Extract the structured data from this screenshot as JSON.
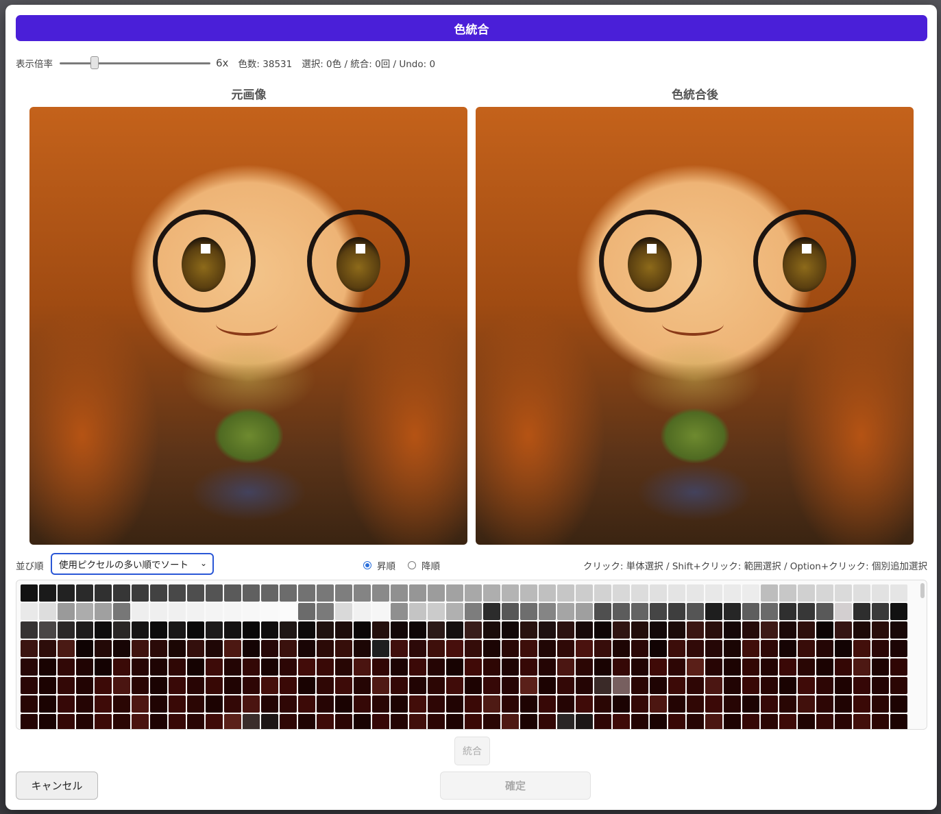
{
  "title": "色統合",
  "zoom": {
    "label": "表示倍率",
    "value_text": "6x",
    "slider_level": 6
  },
  "stats": {
    "colors": "色数: 38531",
    "selection": "選択: 0色 / 統合: 0回 / Undo: 0"
  },
  "panels": {
    "original_title": "元画像",
    "merged_title": "色統合後"
  },
  "sort": {
    "label": "並び順",
    "selected": "使用ピクセルの多い順でソート",
    "ascending": "昇順",
    "descending": "降順",
    "order_selected": "ascending"
  },
  "hint": "クリック: 単体選択 / Shift+クリック: 範囲選択 / Option+クリック: 個別追加選択",
  "buttons": {
    "merge": "統合",
    "cancel": "キャンセル",
    "confirm": "確定"
  },
  "palette_colors": [
    "#121212",
    "#1a1a1a",
    "#222222",
    "#2a2a2a",
    "#303030",
    "#363636",
    "#3c3c3c",
    "#424242",
    "#484848",
    "#4e4e4e",
    "#545454",
    "#5a5a5a",
    "#606060",
    "#666666",
    "#6c6c6c",
    "#727272",
    "#787878",
    "#7e7e7e",
    "#848484",
    "#8a8a8a",
    "#909090",
    "#969696",
    "#9c9c9c",
    "#a2a2a2",
    "#a8a8a8",
    "#aeaeae",
    "#b4b4b4",
    "#bababa",
    "#c0c0c0",
    "#c6c6c6",
    "#cccccc",
    "#d2d2d2",
    "#d8d8d8",
    "#dcdcdc",
    "#e0e0e0",
    "#e4e4e4",
    "#e6e6e6",
    "#e8e8e8",
    "#eaeaea",
    "#ececec",
    "#bdbdbd",
    "#c7c7c7",
    "#d0d0d0",
    "#d6d6d6",
    "#dadada",
    "#dedede",
    "#e2e2e2",
    "#e5e5e5",
    "#e9e9e9",
    "#dddddd",
    "#9a9a9a",
    "#acacac",
    "#a0a0a0",
    "#777777",
    "#eeeeee",
    "#efefef",
    "#f0f0f0",
    "#f2f2f2",
    "#f4f4f4",
    "#f5f5f5",
    "#f7f7f7",
    "#f9f9f9",
    "#fbfbfb",
    "#6b6b6b",
    "#7a7a7a",
    "#d9d9d9",
    "#f1f1f1",
    "#f6f6f6",
    "#8f8f8f",
    "#c4c4c4",
    "#cbcbcb",
    "#b0b0b0",
    "#7d7d7d",
    "#2c2c2c",
    "#575757",
    "#6e6e6e",
    "#858585",
    "#a5a5a5",
    "#9f9f9f",
    "#4f4f4f",
    "#5c5c5c",
    "#646464",
    "#454545",
    "#3e3e3e",
    "#555555",
    "#1e1e1e",
    "#262626",
    "#5e5e5e",
    "#6a6a6a",
    "#2f2f2f",
    "#373737",
    "#595959",
    "#d3cfd0",
    "#2e2e2e",
    "#3a3a3a",
    "#111111",
    "#363333",
    "#4a4646",
    "#2b2828",
    "#1e1c1c",
    "#0e0d0d",
    "#2a2726",
    "#161414",
    "#0c0b0b",
    "#1a1818",
    "#0a0909",
    "#1c1a1a",
    "#141212",
    "#090808",
    "#0f0d0d",
    "#1f1715",
    "#0d0a0a",
    "#20120f",
    "#1d0d0b",
    "#0b0606",
    "#240f0c",
    "#120707",
    "#0f0606",
    "#2b1a18",
    "#151010",
    "#381d1a",
    "#1a0c0a",
    "#110808",
    "#28120f",
    "#1f1010",
    "#2c1210",
    "#170909",
    "#0e0505",
    "#301512",
    "#220d0b",
    "#130808",
    "#1b0b09",
    "#3a1612",
    "#2a0f0c",
    "#150707",
    "#250c0a",
    "#3d1a16",
    "#1c0908",
    "#2e100d",
    "#0d0404",
    "#351513",
    "#1e0a08",
    "#290e0b",
    "#190807",
    "#3b1410",
    "#2d0d0a",
    "#4a1a14",
    "#0f0303",
    "#230907",
    "#170505",
    "#3f130f",
    "#2a0a08",
    "#1b0604",
    "#330f0c",
    "#1f0706",
    "#4c1812",
    "#140404",
    "#260807",
    "#3a110d",
    "#190505",
    "#2b0a07",
    "#360e0a",
    "#1c0605",
    "#1e1f1f",
    "#400f0c",
    "#2c0908",
    "#3e0f0b",
    "#470f0c",
    "#340c09",
    "#1b0504",
    "#290806",
    "#3d0e0a",
    "#200605",
    "#2f0907",
    "#4a120e",
    "#370d0a",
    "#1d0504",
    "#2a0706",
    "#110303",
    "#3c0d0a",
    "#310a08",
    "#250706",
    "#1a0504",
    "#400e0a",
    "#2e0806",
    "#160404",
    "#380c09",
    "#240605",
    "#120303",
    "#420f0b",
    "#2b0706",
    "#1c0404",
    "#280706",
    "#190302",
    "#310806",
    "#200403",
    "#140202",
    "#3a0a07",
    "#270504",
    "#1e0403",
    "#2f0705",
    "#150302",
    "#3d0b08",
    "#230504",
    "#330806",
    "#1a0302",
    "#2c0605",
    "#420c09",
    "#390906",
    "#270604",
    "#4a1410",
    "#310705",
    "#1d0403",
    "#3b0907",
    "#250504",
    "#170302",
    "#400a07",
    "#2e0604",
    "#1f0403",
    "#360806",
    "#240504",
    "#4b1612",
    "#2b0604",
    "#190302",
    "#350806",
    "#210403",
    "#3f0a07",
    "#2d0605",
    "#5a1f18",
    "#270504",
    "#1c0302",
    "#320705",
    "#230403",
    "#3a0806",
    "#290604",
    "#1b0302",
    "#340705",
    "#4d1813",
    "#1e0302",
    "#2f0604",
    "#2a0605",
    "#1c0302",
    "#330806",
    "#220403",
    "#3c0a07",
    "#4a1511",
    "#2a0604",
    "#1a0302",
    "#390907",
    "#280504",
    "#370805",
    "#200403",
    "#2e0605",
    "#450f0b",
    "#3a0906",
    "#190302",
    "#2f0705",
    "#3d0b08",
    "#250504",
    "#4f1a14",
    "#340806",
    "#210403",
    "#2c0604",
    "#400c09",
    "#1d0302",
    "#360807",
    "#270504",
    "#5a2019",
    "#1c0302",
    "#330806",
    "#240504",
    "#3a2a28",
    "#775f5f",
    "#2b0604",
    "#1f0403",
    "#3c0a07",
    "#2e0605",
    "#4b1612",
    "#210403",
    "#380806",
    "#290504",
    "#1a0302",
    "#3f0b08",
    "#2d0605",
    "#1e0302",
    "#350706",
    "#230404",
    "#2b0604",
    "#280604",
    "#1b0302",
    "#360807",
    "#250504",
    "#3e0b08",
    "#2a0604",
    "#4d1712",
    "#200403",
    "#390906",
    "#2b0604",
    "#1c0302",
    "#330806",
    "#4a1410",
    "#230403",
    "#2f0705",
    "#3c0a07",
    "#260504",
    "#1a0302",
    "#350806",
    "#290604",
    "#1d0302",
    "#420d09",
    "#2e0605",
    "#210403",
    "#3a0906",
    "#4e1a14",
    "#2c0604",
    "#1e0302",
    "#370806",
    "#250504",
    "#3f0b08",
    "#2a0604",
    "#1b0302",
    "#340806",
    "#4c1611",
    "#230403",
    "#300705",
    "#3b0907",
    "#270504",
    "#1c0302",
    "#360807",
    "#290604",
    "#41100c",
    "#2d0605",
    "#200403",
    "#3a0906",
    "#2a0604",
    "#1d0302",
    "#250504",
    "#1a0302",
    "#340806",
    "#220403",
    "#3c0a07",
    "#2a0604",
    "#4a1410",
    "#1e0302",
    "#370806",
    "#280504",
    "#3f0b08",
    "#5a211a",
    "#3a2d2b",
    "#1c1515",
    "#2f0705",
    "#200403",
    "#3e0b08",
    "#2b0604",
    "#190302",
    "#360807",
    "#240504",
    "#410f0b",
    "#2c0604",
    "#1d0302",
    "#3a0906",
    "#290604",
    "#4e1913",
    "#1b0302",
    "#330806",
    "#2a2626",
    "#1c1717",
    "#2e0605",
    "#3f0b08",
    "#230403",
    "#1a0302",
    "#380806",
    "#270504",
    "#4b1612",
    "#1e0302",
    "#350806",
    "#2a0604",
    "#3d0a07",
    "#200403",
    "#330806",
    "#290504",
    "#420f0b",
    "#2c0604",
    "#1c0302"
  ]
}
